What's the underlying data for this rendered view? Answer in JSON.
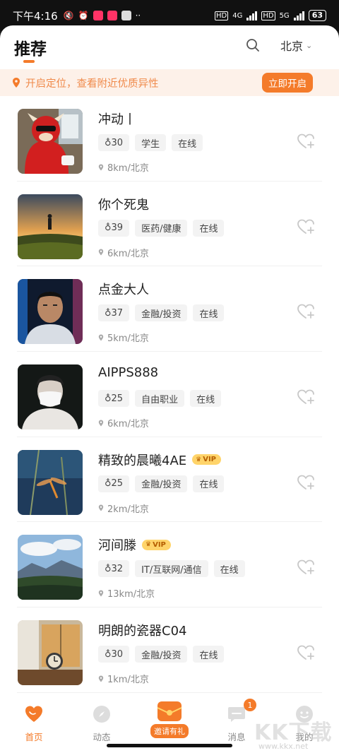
{
  "status_bar": {
    "time": "下午4:16",
    "net_left": "4G",
    "net_right": "5G",
    "hd": "HD",
    "battery": "63"
  },
  "header": {
    "title": "推荐",
    "city": "北京"
  },
  "location_banner": {
    "text": "开启定位，查看附近优质异性",
    "button": "立即开启"
  },
  "users": [
    {
      "name": "冲动丨",
      "vip": false,
      "age": "30",
      "tags": [
        "学生",
        "在线"
      ],
      "location": "8km/北京",
      "avatar": "red-bull-mascot"
    },
    {
      "name": "你个死鬼",
      "vip": false,
      "age": "39",
      "tags": [
        "医药/健康",
        "在线"
      ],
      "location": "6km/北京",
      "avatar": "sunset-silhouette"
    },
    {
      "name": "点金大人",
      "vip": false,
      "age": "37",
      "tags": [
        "金融/投资",
        "在线"
      ],
      "location": "5km/北京",
      "avatar": "man-portrait"
    },
    {
      "name": "AIPPS888",
      "vip": false,
      "age": "25",
      "tags": [
        "自由职业",
        "在线"
      ],
      "location": "6km/北京",
      "avatar": "masked-person"
    },
    {
      "name": "精致的晨曦4AE",
      "vip": true,
      "age": "25",
      "tags": [
        "金融/投资",
        "在线"
      ],
      "location": "2km/北京",
      "avatar": "dragonfly"
    },
    {
      "name": "河间滕",
      "vip": true,
      "age": "32",
      "tags": [
        "IT/互联网/通信",
        "在线"
      ],
      "location": "13km/北京",
      "avatar": "mountain-landscape"
    },
    {
      "name": "明朗的瓷器C04",
      "vip": false,
      "age": "30",
      "tags": [
        "金融/投资",
        "在线"
      ],
      "location": "1km/北京",
      "avatar": "clock-window"
    }
  ],
  "vip_label": "VIP",
  "tabbar": {
    "home": "首页",
    "moments": "动态",
    "invite": "邀请有礼",
    "messages": "消息",
    "messages_badge": "1",
    "mine": "我的"
  },
  "watermark": {
    "text": "KK下载",
    "url": "www.kkx.net"
  },
  "colors": {
    "accent": "#f47b2a",
    "banner_bg": "#fdf1e9",
    "vip_bg": "#ffd46a"
  }
}
